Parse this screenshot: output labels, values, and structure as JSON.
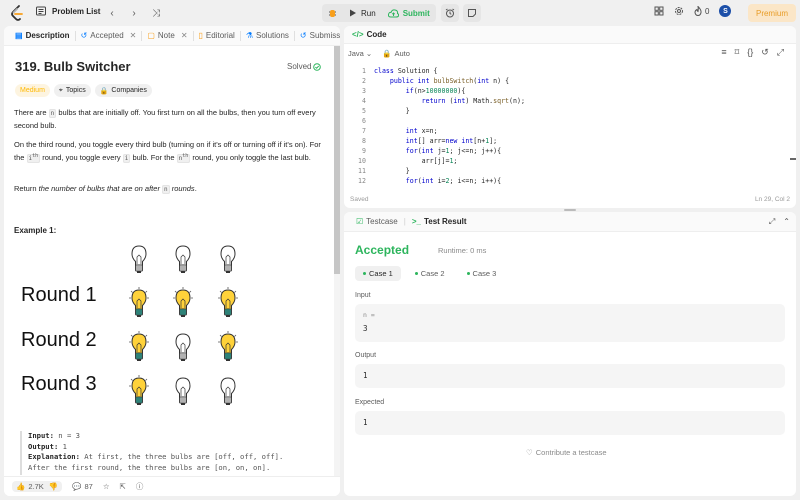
{
  "topbar": {
    "problem_list": "Problem List",
    "run": "Run",
    "submit": "Submit",
    "streak_count": "0",
    "avatar_letter": "S",
    "premium": "Premium"
  },
  "left_tabs": [
    {
      "label": "Description",
      "icon": "description-icon"
    },
    {
      "label": "Accepted",
      "icon": "history-icon"
    },
    {
      "label": "Note",
      "icon": "note-icon"
    },
    {
      "label": "Editorial",
      "icon": "editorial-icon"
    },
    {
      "label": "Solutions",
      "icon": "flask-icon"
    },
    {
      "label": "Submissi",
      "icon": "history-icon"
    }
  ],
  "problem": {
    "title": "319. Bulb Switcher",
    "status": "Solved",
    "difficulty": "Medium",
    "topics_tag": "Topics",
    "companies_tag": "Companies",
    "p1_a": "There are ",
    "p1_code": "n",
    "p1_b": " bulbs that are initially off. You first turn on all the bulbs, then you turn off every second bulb.",
    "p2_a": "On the third round, you toggle every third bulb (turning on if it's off or turning off if it's on). For the ",
    "p2_code1": "i",
    "p2_sup1": "th",
    "p2_b": " round, you toggle every ",
    "p2_code2": "i",
    "p2_c": " bulb. For the ",
    "p2_code3": "n",
    "p2_sup2": "th",
    "p2_d": " round, you only toggle the last bulb.",
    "p3_a": "Return ",
    "p3_em": "the number of bulbs that are on after",
    "p3_code": "n",
    "p3_em2": "rounds",
    "p3_end": ".",
    "example_title": "Example 1:",
    "rounds": [
      "Round 1",
      "Round 2",
      "Round 3"
    ],
    "example": {
      "input_label": "Input:",
      "input_value": "n = 3",
      "output_label": "Output:",
      "output_value": "1",
      "explanation_label": "Explanation:",
      "explanation_1": "At first, the three bulbs are [off, off, off].",
      "explanation_2": "After the first round, the three bulbs are [on, on, on]."
    }
  },
  "footer": {
    "likes": "2.7K",
    "comments": "87"
  },
  "code": {
    "header": "Code",
    "language": "Java",
    "auto": "Auto",
    "line_numbers": [
      "1",
      "2",
      "3",
      "4",
      "5",
      "6",
      "7",
      "8",
      "9",
      "10",
      "11",
      "12"
    ],
    "saved": "Saved",
    "cursor": "Ln 29, Col 2"
  },
  "result": {
    "tab_testcase": "Testcase",
    "tab_result": "Test Result",
    "status": "Accepted",
    "runtime": "Runtime: 0 ms",
    "cases": [
      "Case 1",
      "Case 2",
      "Case 3"
    ],
    "input_label": "Input",
    "input_var": "n =",
    "input_value": "3",
    "output_label": "Output",
    "output_value": "1",
    "expected_label": "Expected",
    "expected_value": "1",
    "contribute": "Contribute a testcase"
  },
  "colors": {
    "accepted": "#2db55d",
    "medium": "#ffb800",
    "premium": "#e89c26",
    "keyword": "#0000cd"
  }
}
